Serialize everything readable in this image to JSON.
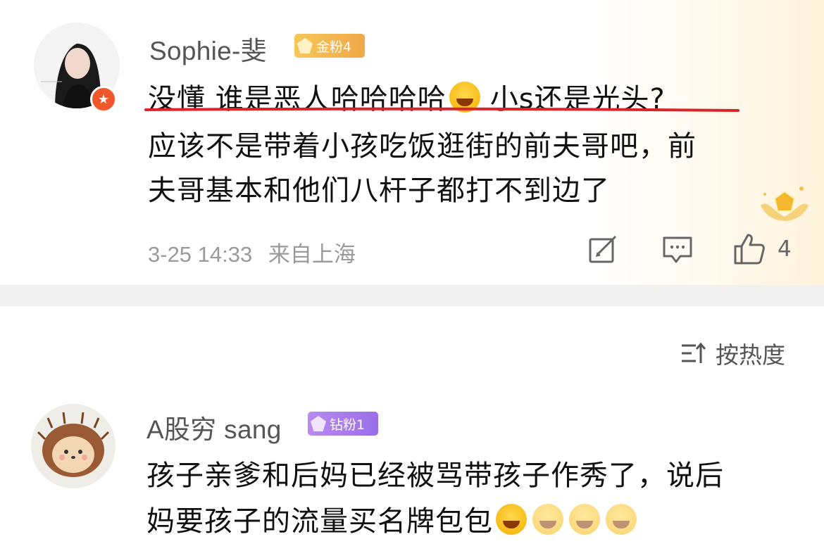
{
  "comments": [
    {
      "username": "Sophie-斐",
      "fan_badge": "金粉4",
      "lines": [
        "没懂 谁是恶人哈哈哈哈",
        "小s还是光头?",
        "应该不是带着小孩吃饭逛街的前夫哥吧，前",
        "夫哥基本和他们八杆子都打不到边了"
      ],
      "date": "3-25 14:33",
      "location": "来自上海",
      "like_count": "4"
    },
    {
      "username": "A股穷 sang",
      "fan_badge": "钻粉1",
      "lines": [
        "孩子亲爹和后妈已经被骂带孩子作秀了，说后",
        "妈要孩子的流量买名牌包包"
      ]
    }
  ],
  "sort": {
    "label": "按热度"
  },
  "icons": {
    "emoji": "laugh-cry-emoji",
    "verified": "star-badge-icon",
    "repost": "repost-icon",
    "reply": "comment-icon",
    "like": "thumbs-up-icon",
    "sort": "sort-icon"
  },
  "colors": {
    "underline": "#d9242a",
    "gold_badge": "#f0b04f",
    "diamond_badge": "#a57aee",
    "verified": "#f0572b"
  }
}
